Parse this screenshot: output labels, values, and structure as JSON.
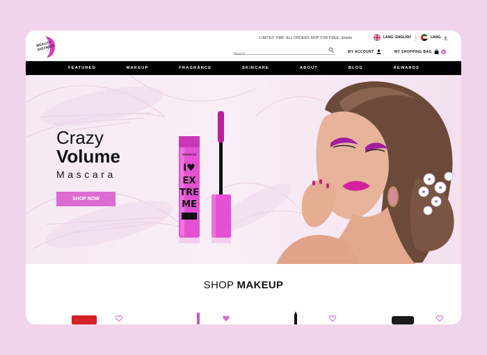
{
  "brand": {
    "logo_text": "BEAUTY DISTRICT"
  },
  "topbar": {
    "promo": "LIMITED TIME: ALL ORDERS SHIP FOR FREE. details",
    "lang_english": "LANG: ENGLISH",
    "lang_arabic": "LANG:",
    "lang_arabic_glyph": "ع",
    "search_placeholder": "Search",
    "my_account": "MY ACCOUNT",
    "my_bag": "MY SHOPPING BAG",
    "bag_count": "0"
  },
  "nav": {
    "items": [
      "FEATURED",
      "MAKEUP",
      "FRAGRANCE",
      "SKINCARE",
      "ABOUT",
      "BLOG",
      "REWARDS"
    ]
  },
  "hero": {
    "line1": "Crazy",
    "line2": "Volume",
    "line3": "Mascara",
    "cta": "SHOP NOW",
    "product_brand": "essence",
    "product_name": "I ♥ EXTREME"
  },
  "section": {
    "title_light": "SHOP ",
    "title_bold": "MAKEUP"
  },
  "colors": {
    "accent": "#dc6bd3",
    "nav_bg": "#000000",
    "page_bg": "#f1d4ec"
  }
}
